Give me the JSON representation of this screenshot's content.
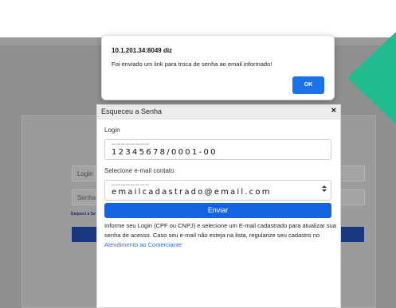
{
  "background_page": {
    "login_label": "Login",
    "senha_label": "Senha",
    "esqueci_link": "Esqueci a Se"
  },
  "modal": {
    "title": "Esqueceu a Senha",
    "close_label": "×",
    "login_label": "Login",
    "login_value": "12345678/0001-00",
    "email_label": "Selecione e-mail contato",
    "email_value": "emailcadastrado@email.com",
    "submit_label": "Enviar",
    "info_text": "Informe seu Login (CPF ou CNPJ) e selecione um E-mail cadastrado para atualizar sua senha de acesso. Caso seu e-mail não esteja na lista, regularize seu cadastro no ",
    "info_link": "Atendimento ao Comerciante"
  },
  "alert": {
    "title": "10.1.201.34:8049 diz",
    "message": "Foi enviado um link para troca de senha ao email informado!",
    "ok_label": "OK"
  },
  "colors": {
    "accent_green": "#21bb8f",
    "primary_blue": "#1463e0"
  },
  "icons": {
    "close": "close-icon",
    "select_arrows": "chevron-updown-icon"
  }
}
